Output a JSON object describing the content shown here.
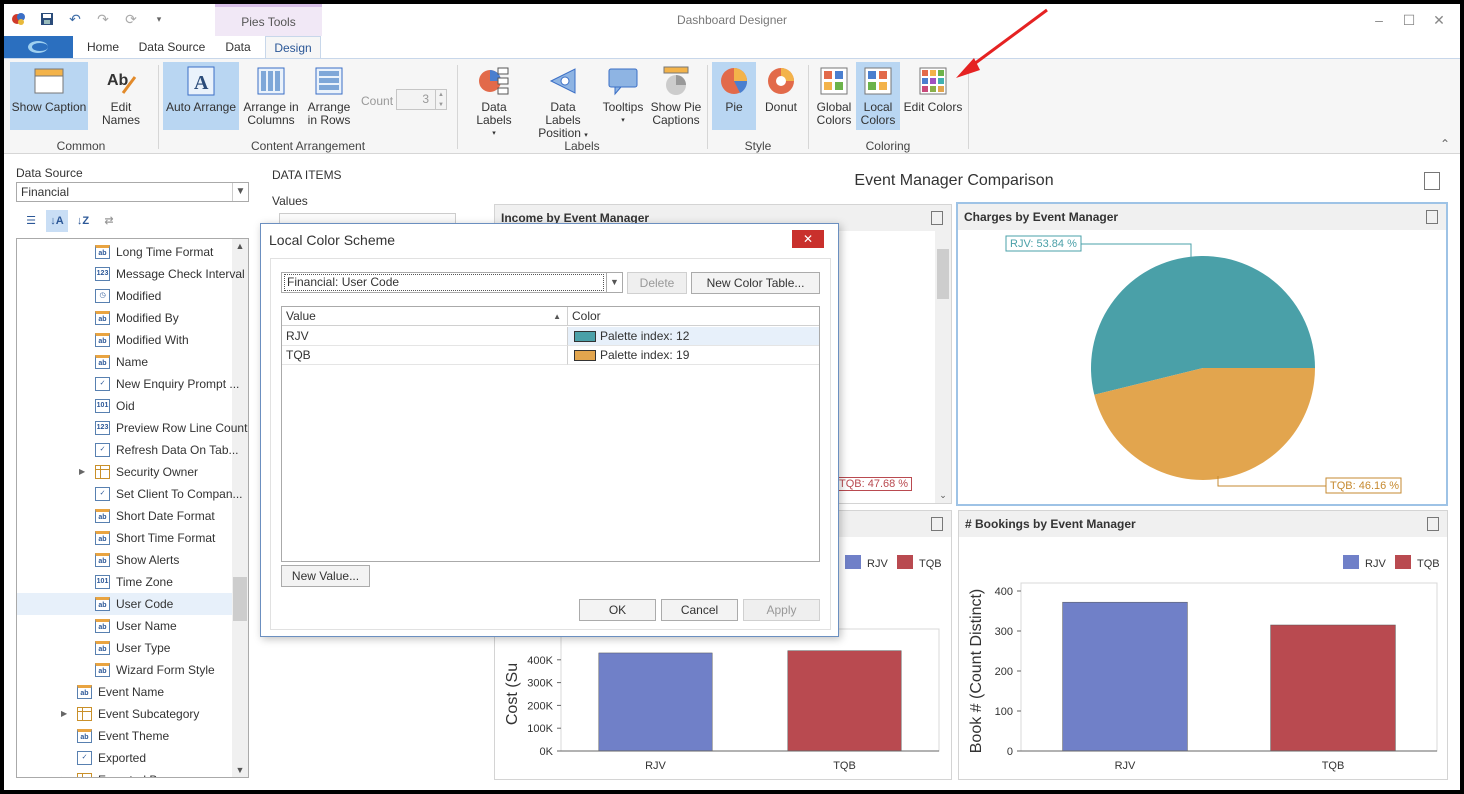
{
  "window": {
    "title": "Dashboard Designer",
    "context_tab_group": "Pies Tools",
    "controls": [
      "–",
      "☐",
      "✕"
    ]
  },
  "ribbon_tabs": [
    "Home",
    "Data Source",
    "Data",
    "Design"
  ],
  "ribbon": {
    "common": {
      "label": "Common",
      "show_caption": "Show Caption",
      "edit_names": "Edit Names"
    },
    "content_arrangement": {
      "label": "Content Arrangement",
      "auto_arrange": "Auto Arrange",
      "arrange_columns": [
        "Arrange in",
        "Columns"
      ],
      "arrange_rows": [
        "Arrange",
        "in Rows"
      ],
      "count_label": "Count",
      "count_value": "3"
    },
    "labels": {
      "label": "Labels",
      "data_labels": "Data Labels",
      "data_labels_position": [
        "Data Labels",
        "Position"
      ],
      "tooltips": "Tooltips",
      "show_pie_captions": [
        "Show Pie",
        "Captions"
      ]
    },
    "style": {
      "label": "Style",
      "pie": "Pie",
      "donut": "Donut"
    },
    "coloring": {
      "label": "Coloring",
      "global_colors": [
        "Global",
        "Colors"
      ],
      "local_colors": [
        "Local",
        "Colors"
      ],
      "edit_colors": "Edit Colors"
    }
  },
  "left_panel": {
    "data_source_label": "Data Source",
    "data_source_value": "Financial",
    "fields": [
      {
        "name": "Long Time Format",
        "icon": "ab"
      },
      {
        "name": "Message Check Interval",
        "icon": "123"
      },
      {
        "name": "Modified",
        "icon": "clock"
      },
      {
        "name": "Modified By",
        "icon": "ab"
      },
      {
        "name": "Modified With",
        "icon": "ab"
      },
      {
        "name": "Name",
        "icon": "ab"
      },
      {
        "name": "New Enquiry Prompt ...",
        "icon": "check"
      },
      {
        "name": "Oid",
        "icon": "101"
      },
      {
        "name": "Preview Row Line Count",
        "icon": "123"
      },
      {
        "name": "Refresh Data On Tab...",
        "icon": "check"
      },
      {
        "name": "Security Owner",
        "icon": "table"
      },
      {
        "name": "Set Client To Compan...",
        "icon": "check"
      },
      {
        "name": "Short Date Format",
        "icon": "ab"
      },
      {
        "name": "Short Time Format",
        "icon": "ab"
      },
      {
        "name": "Show Alerts",
        "icon": "ab"
      },
      {
        "name": "Time Zone",
        "icon": "101"
      },
      {
        "name": "User Code",
        "icon": "ab"
      },
      {
        "name": "User Name",
        "icon": "ab"
      },
      {
        "name": "User Type",
        "icon": "ab"
      },
      {
        "name": "Wizard Form Style",
        "icon": "ab"
      },
      {
        "name": "Event Name",
        "icon": "ab"
      },
      {
        "name": "Event Subcategory",
        "icon": "table"
      },
      {
        "name": "Event Theme",
        "icon": "ab"
      },
      {
        "name": "Exported",
        "icon": "check"
      },
      {
        "name": "Exported By",
        "icon": "table"
      }
    ]
  },
  "data_items": {
    "title": "DATA ITEMS",
    "values_label": "Values"
  },
  "dashboard": {
    "title": "Event Manager Comparison",
    "items": {
      "income": {
        "caption": "Income by Event Manager",
        "label_tqb": "TQB: 47.68 %"
      },
      "charges": {
        "caption": "Charges by Event Manager"
      },
      "cost": {
        "caption": ""
      },
      "bookings": {
        "caption": "# Bookings by Event Manager"
      }
    }
  },
  "dialog": {
    "title": "Local Color Scheme",
    "close": "✕",
    "combo_value": "Financial: User Code",
    "delete_label": "Delete",
    "new_color_table_label": "New Color Table...",
    "columns": [
      "Value",
      "Color"
    ],
    "rows": [
      {
        "value": "RJV",
        "color_label": "Palette index: 12",
        "swatch": "#4aa0a8"
      },
      {
        "value": "TQB",
        "color_label": "Palette index: 19",
        "swatch": "#e2a54e"
      }
    ],
    "new_value_label": "New Value...",
    "ok_label": "OK",
    "cancel_label": "Cancel",
    "apply_label": "Apply"
  },
  "colors": {
    "rjv_pie": "#4aa0a8",
    "tqb_pie": "#e2a54e",
    "rjv_bar": "#7080c8",
    "tqb_bar": "#b94a50",
    "arrow": "#e52222"
  },
  "chart_data": [
    {
      "type": "pie",
      "title": "Charges by Event Manager",
      "categories": [
        "RJV",
        "TQB"
      ],
      "values": [
        53.84,
        46.16
      ],
      "labels": [
        "RJV: 53.84 %",
        "TQB: 46.16 %"
      ]
    },
    {
      "type": "bar",
      "title": "",
      "categories": [
        "RJV",
        "TQB"
      ],
      "series": [
        {
          "name": "RJV",
          "values": [
            430
          ]
        },
        {
          "name": "TQB",
          "values": [
            440
          ]
        }
      ],
      "ylabel": "Cost (Sum)",
      "yticks": [
        "0K",
        "100K",
        "200K",
        "300K",
        "400K"
      ],
      "visible_ylabel": "Cost (Su",
      "ylim": [
        0,
        500
      ]
    },
    {
      "type": "bar",
      "title": "# Bookings by Event Manager",
      "categories": [
        "RJV",
        "TQB"
      ],
      "series": [
        {
          "name": "RJV",
          "values": [
            372
          ]
        },
        {
          "name": "TQB",
          "values": [
            315
          ]
        }
      ],
      "ylabel": "Book # (Count Distinct)",
      "yticks": [
        "0",
        "100",
        "200",
        "300",
        "400"
      ],
      "ylim": [
        0,
        400
      ]
    }
  ]
}
